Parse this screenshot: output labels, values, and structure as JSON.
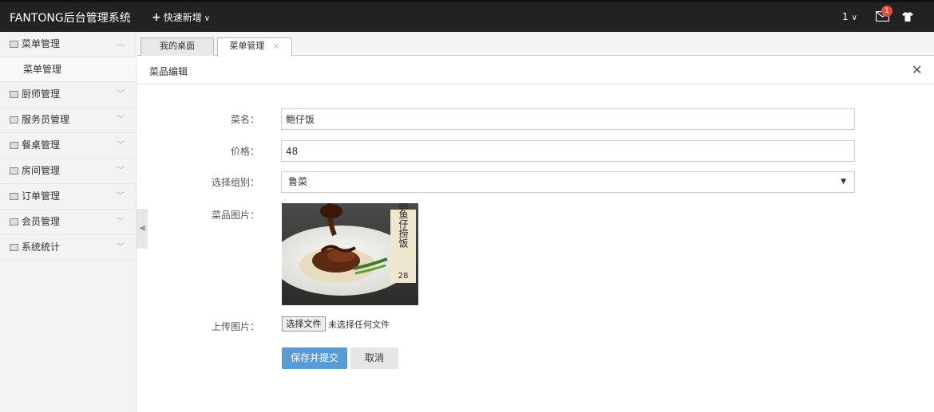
{
  "header": {
    "app_title": "FANTONG后台管理系统",
    "quick_add_label": "快速新增",
    "user_label": "1",
    "notification_count": "1"
  },
  "sidebar": {
    "items": [
      {
        "label": "菜单管理",
        "expanded": true,
        "sub": [
          {
            "label": "菜单管理"
          }
        ]
      },
      {
        "label": "厨师管理"
      },
      {
        "label": "服务员管理"
      },
      {
        "label": "餐桌管理"
      },
      {
        "label": "房间管理"
      },
      {
        "label": "订单管理"
      },
      {
        "label": "会员管理"
      },
      {
        "label": "系统统计"
      }
    ]
  },
  "tabs": [
    {
      "label": "我的桌面"
    },
    {
      "label": "菜单管理",
      "active": true
    }
  ],
  "panel": {
    "title": "菜品编辑"
  },
  "form": {
    "name_label": "菜名：",
    "name_value": "鲍仔饭",
    "price_label": "价格：",
    "price_value": "48",
    "group_label": "选择组别：",
    "group_value": "鲁菜",
    "image_label": "菜品图片：",
    "image_overlay_text": "鲍鱼仔捞饭",
    "image_overlay_price": "28",
    "upload_label": "上传图片：",
    "file_button_label": "选择文件",
    "file_status": "未选择任何文件",
    "save_label": "保存并提交",
    "cancel_label": "取消"
  },
  "colors": {
    "topbar": "#222222",
    "primary_button": "#5b9bd5",
    "badge": "#e64b3c"
  }
}
